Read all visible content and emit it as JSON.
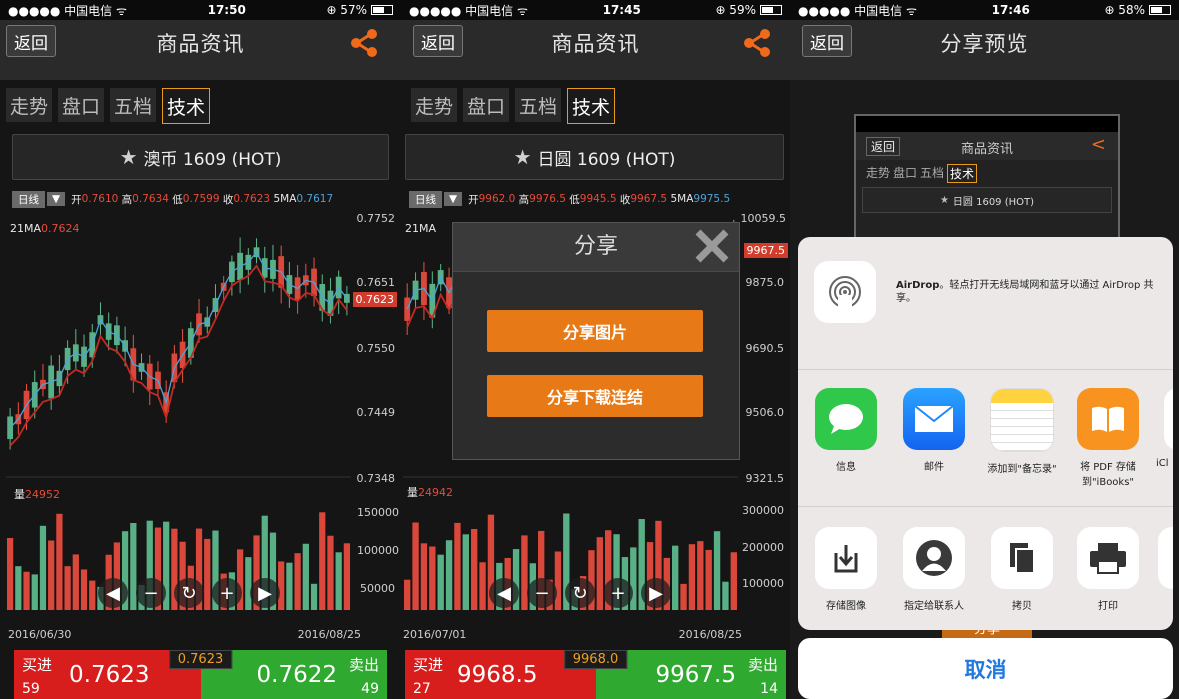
{
  "panel1": {
    "status": {
      "carrier": "●●●●● 中国电信 ᯤ",
      "time": "17:50",
      "battery": "⊕ 57%"
    },
    "nav": {
      "back": "返回",
      "title": "商品资讯"
    },
    "tabs": [
      "走势",
      "盘口",
      "五档",
      "技术"
    ],
    "active_tab": 3,
    "product": "澳币 1609 (HOT)",
    "ohlc": {
      "period": "日线",
      "open_lbl": "开",
      "open": "0.7610",
      "high_lbl": "高",
      "high": "0.7634",
      "low_lbl": "低",
      "low": "0.7599",
      "close_lbl": "收",
      "close": "0.7623",
      "ma5_lbl": "5MA",
      "ma5": "0.7617"
    },
    "ma21_lbl": "21MA",
    "ma21": "0.7624",
    "y_labels": [
      "0.7752",
      "0.7651",
      "0.7623",
      "0.7550",
      "0.7449",
      "0.7348"
    ],
    "volume_lbl": "量",
    "volume": "24952",
    "vol_labels": [
      "150000",
      "100000",
      "50000"
    ],
    "dates": [
      "2016/06/30",
      "2016/08/25"
    ],
    "bottom": {
      "buy_lbl": "买进",
      "buy_price": "0.7623",
      "buy_qty": "59",
      "mid": "0.7623",
      "sell_lbl": "卖出",
      "sell_price": "0.7622",
      "sell_qty": "49"
    }
  },
  "panel2": {
    "status": {
      "carrier": "●●●●● 中国电信 ᯤ",
      "time": "17:45",
      "battery": "⊕ 59%"
    },
    "nav": {
      "back": "返回",
      "title": "商品资讯"
    },
    "tabs": [
      "走势",
      "盘口",
      "五档",
      "技术"
    ],
    "product": "日圆 1609 (HOT)",
    "ohlc": {
      "period": "日线",
      "open_lbl": "开",
      "open": "9962.0",
      "high_lbl": "高",
      "high": "9976.5",
      "low_lbl": "低",
      "low": "9945.5",
      "close_lbl": "收",
      "close": "9967.5",
      "ma5_lbl": "5MA",
      "ma5": "9975.5"
    },
    "ma21_lbl": "21MA",
    "y_labels": [
      "10059.5",
      "9967.5",
      "9875.0",
      "9690.5",
      "9506.0",
      "9321.5"
    ],
    "volume_lbl": "量",
    "volume": "24942",
    "vol_labels": [
      "300000",
      "200000",
      "100000"
    ],
    "dates": [
      "2016/07/01",
      "2016/08/25"
    ],
    "modal": {
      "title": "分享",
      "btn1": "分享图片",
      "btn2": "分享下载连结"
    },
    "bottom": {
      "buy_lbl": "买进",
      "buy_price": "9968.5",
      "buy_qty": "27",
      "mid": "9968.0",
      "sell_lbl": "卖出",
      "sell_price": "9967.5",
      "sell_qty": "14"
    }
  },
  "panel3": {
    "status": {
      "carrier": "●●●●● 中国电信 ᯤ",
      "time": "17:46",
      "battery": "⊕ 58%"
    },
    "nav": {
      "back": "返回",
      "title": "分享预览"
    },
    "preview": {
      "back": "返回",
      "title": "商品资讯",
      "tabs": [
        "走势",
        "盘口",
        "五档",
        "技术"
      ],
      "product": "日圆 1609 (HOT)"
    },
    "airdrop": {
      "name": "AirDrop",
      "text": "。轻点打开无线局域网和蓝牙以通过 AirDrop 共享。"
    },
    "apps": [
      {
        "label": "信息",
        "icon": "messages-icon",
        "color": "#2fc84a"
      },
      {
        "label": "邮件",
        "icon": "mail-icon",
        "color": "#1e88ff"
      },
      {
        "label": "添加到\"备忘录\"",
        "icon": "notes-icon",
        "color": "#ffffff"
      },
      {
        "label": "将 PDF 存储到\"iBooks\"",
        "icon": "ibooks-icon",
        "color": "#f7931e"
      },
      {
        "label": "iCl",
        "icon": "icloud-icon",
        "color": "#ffffff"
      }
    ],
    "actions": [
      {
        "label": "存储图像",
        "icon": "save-image-icon"
      },
      {
        "label": "指定给联系人",
        "icon": "contact-icon"
      },
      {
        "label": "拷贝",
        "icon": "copy-icon"
      },
      {
        "label": "打印",
        "icon": "print-icon"
      }
    ],
    "cancel": "取消",
    "behind_btn": "分享"
  }
}
